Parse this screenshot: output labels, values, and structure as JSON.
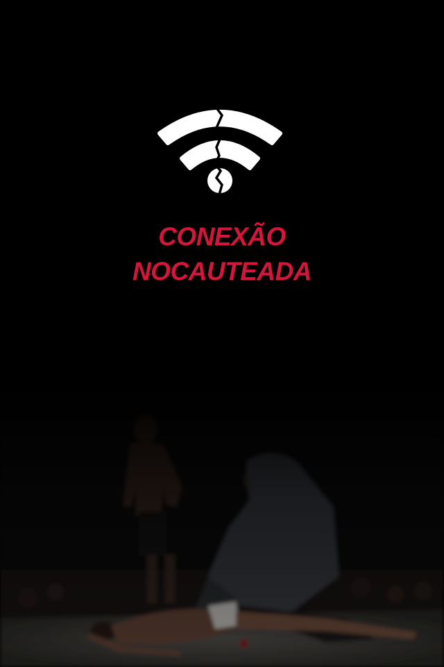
{
  "error_screen": {
    "icon": "broken-wifi-icon",
    "title_line1": "CONEXÃO",
    "title_line2": "NOCAUTEADA"
  },
  "background": {
    "description_icon": "fight-knockout-photo"
  },
  "colors": {
    "background": "#000000",
    "title": "#d4163a",
    "icon": "#ffffff"
  }
}
